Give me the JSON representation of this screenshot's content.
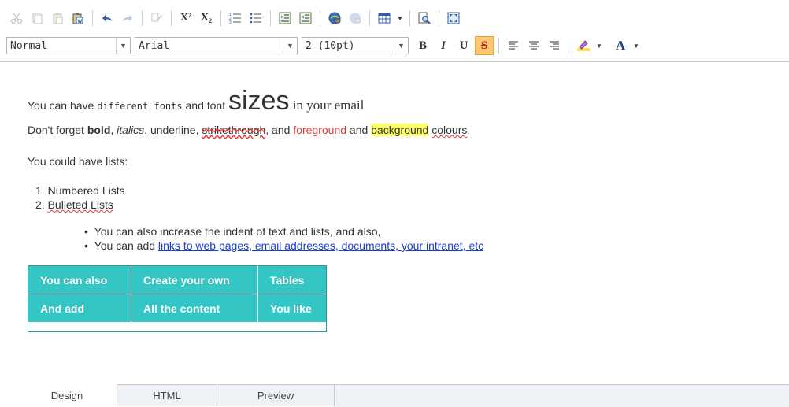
{
  "toolbar": {
    "superscript_glyph": "X²",
    "subscript_glyph": "X₂"
  },
  "formatbar": {
    "style_value": "Normal",
    "font_value": "Arial",
    "size_value": "2 (10pt)",
    "bold_label": "B",
    "italic_label": "I",
    "underline_label": "U",
    "strike_label": "S",
    "forecolor_label": "A"
  },
  "editor": {
    "line1": {
      "a": "You can have ",
      "b": "different fonts",
      "c": " and font ",
      "d": "sizes",
      "e": " in your email"
    },
    "line2": {
      "a": "Don't forget ",
      "bold": "bold",
      "s1": ", ",
      "italics": "italics",
      "s2": ", ",
      "underline": "underline",
      "s3": ", ",
      "strike": "strikethrough",
      "s4": ", and ",
      "foreground": "foreground",
      "s5": " and ",
      "background": "background",
      "s6": " ",
      "colours": "colours",
      "s7": "."
    },
    "line3": "You could have lists:",
    "numbered": [
      "Numbered Lists",
      "Bulleted Lists"
    ],
    "bullets": {
      "first": "You can also increase the indent of text and lists, and also,",
      "second_prefix": "You can add ",
      "second_link": "links to web pages, email addresses, documents, your intranet, etc"
    },
    "table": [
      [
        "You can also",
        "Create your own",
        "Tables"
      ],
      [
        "And add",
        "All the content",
        "You like"
      ]
    ]
  },
  "tabs": {
    "design": "Design",
    "html": "HTML",
    "preview": "Preview"
  },
  "colors": {
    "table_bg": "#34c5c5",
    "active_button": "#ffc870",
    "foreground_text": "#e53935",
    "highlight": "#ffff66",
    "link": "#1a3dd6"
  }
}
